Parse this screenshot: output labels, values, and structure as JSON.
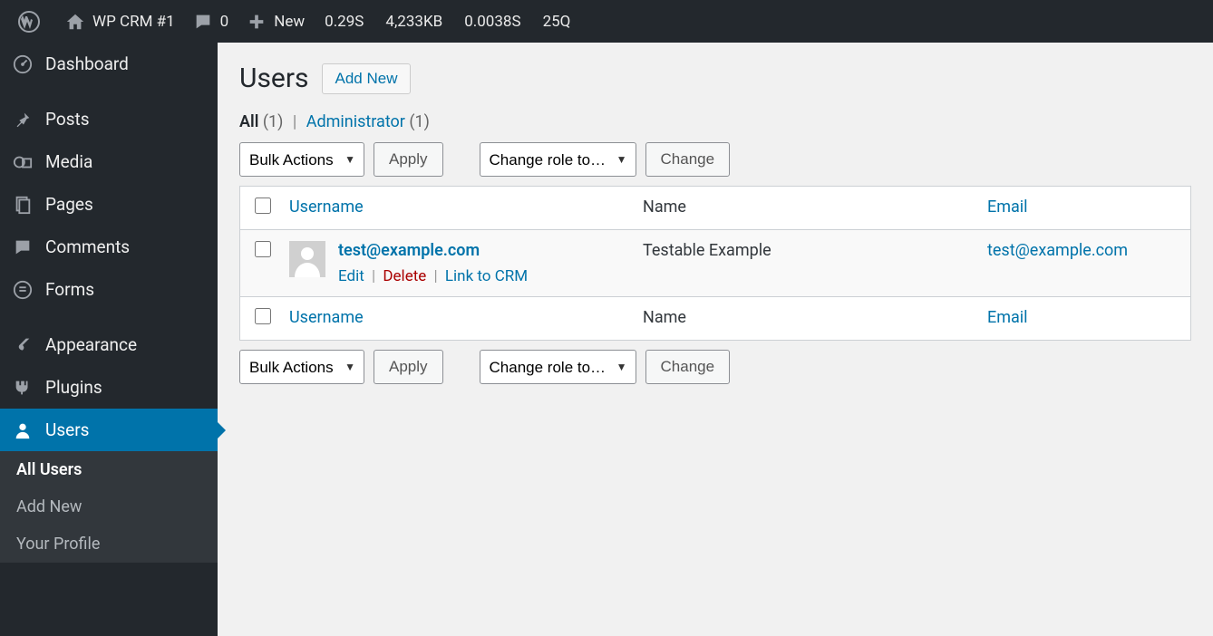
{
  "adminbar": {
    "site_name": "WP CRM #1",
    "comments_count": "0",
    "new_label": "New",
    "metrics": [
      "0.29S",
      "4,233KB",
      "0.0038S",
      "25Q"
    ]
  },
  "sidebar": {
    "items": [
      {
        "id": "dashboard",
        "label": "Dashboard"
      },
      {
        "id": "posts",
        "label": "Posts"
      },
      {
        "id": "media",
        "label": "Media"
      },
      {
        "id": "pages",
        "label": "Pages"
      },
      {
        "id": "comments",
        "label": "Comments"
      },
      {
        "id": "forms",
        "label": "Forms"
      },
      {
        "id": "appearance",
        "label": "Appearance"
      },
      {
        "id": "plugins",
        "label": "Plugins"
      },
      {
        "id": "users",
        "label": "Users"
      }
    ],
    "users_sub": [
      {
        "label": "All Users",
        "current": true
      },
      {
        "label": "Add New",
        "current": false
      },
      {
        "label": "Your Profile",
        "current": false
      }
    ]
  },
  "page": {
    "title": "Users",
    "add_new_btn": "Add New"
  },
  "filters": {
    "all_label": "All",
    "all_count": "(1)",
    "sep": "|",
    "admin_label": "Administrator",
    "admin_count": "(1)"
  },
  "controls": {
    "bulk_select": "Bulk Actions",
    "apply_btn": "Apply",
    "role_select": "Change role to…",
    "change_btn": "Change"
  },
  "table": {
    "cols": {
      "username": "Username",
      "name": "Name",
      "email": "Email"
    },
    "rows": [
      {
        "username": "test@example.com",
        "name": "Testable Example",
        "email": "test@example.com",
        "actions": {
          "edit": "Edit",
          "delete": "Delete",
          "link_crm": "Link to CRM"
        }
      }
    ]
  }
}
